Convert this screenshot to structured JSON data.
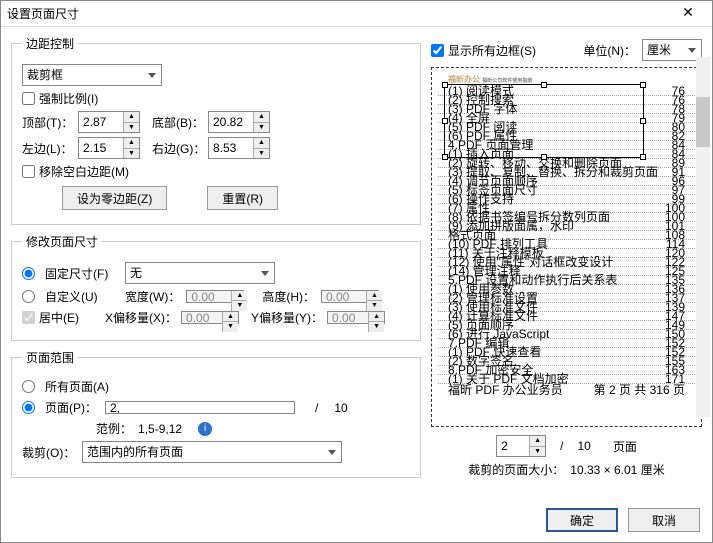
{
  "title": "设置页面尺寸",
  "header": {
    "show_all_boxes": "显示所有边框(S)",
    "unit_label": "单位(N)：",
    "unit": "厘米"
  },
  "margin": {
    "legend": "边距控制",
    "dropdown": "裁剪框",
    "force_ratio": "强制比例(I)",
    "top_label": "顶部(T)：",
    "top": "2.87",
    "bottom_label": "底部(B)：",
    "bottom": "20.82",
    "left_label": "左边(L)：",
    "left": "2.15",
    "right_label": "右边(G)：",
    "right": "8.53",
    "remove_white": "移除空白边距(M)",
    "zero_btn": "设为零边距(Z)",
    "reset_btn": "重置(R)"
  },
  "resize": {
    "legend": "修改页面尺寸",
    "fixed": "固定尺寸(F)",
    "fixed_val": "无",
    "custom": "自定义(U)",
    "width_label": "宽度(W)：",
    "width": "0.00",
    "height_label": "高度(H)：",
    "height": "0.00",
    "center": "居中(E)",
    "xoff_label": "X偏移量(X)：",
    "xoff": "0.00",
    "yoff_label": "Y偏移量(Y)：",
    "yoff": "0.00"
  },
  "range": {
    "legend": "页面范围",
    "all": "所有页面(A)",
    "pages": "页面(P)：",
    "pages_val": "2,",
    "of": "/",
    "total": "10",
    "example_label": "范例：",
    "example": "1,5-9,12",
    "crop_label": "裁剪(O)：",
    "crop_val": "范围内的所有页面"
  },
  "preview": {
    "page_spin": "2",
    "slash": "/",
    "total": "10",
    "page_word": "页面",
    "crop_size_label": "裁剪的页面大小：",
    "crop_size": "10.33 × 6.01 厘米"
  },
  "footer": {
    "ok": "确定",
    "cancel": "取消"
  }
}
